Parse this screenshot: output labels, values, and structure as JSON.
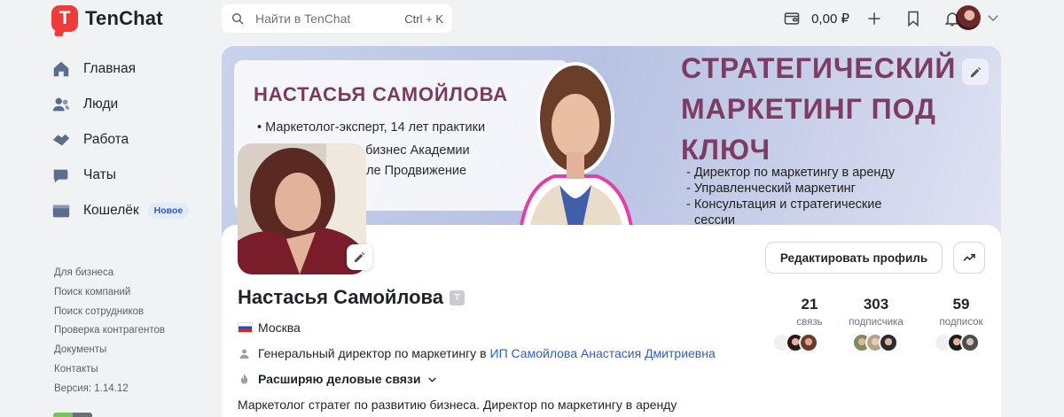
{
  "brand": {
    "name": "TenChat",
    "mark": "T"
  },
  "search": {
    "placeholder": "Найти в TenChat",
    "shortcut": "Ctrl + K"
  },
  "wallet": {
    "amount": "0,00 ₽"
  },
  "nav": [
    {
      "label": "Главная",
      "icon": "home-icon"
    },
    {
      "label": "Люди",
      "icon": "people-icon"
    },
    {
      "label": "Работа",
      "icon": "work-icon"
    },
    {
      "label": "Чаты",
      "icon": "chat-icon"
    },
    {
      "label": "Кошелёк",
      "icon": "wallet-icon",
      "badge": "Новое"
    }
  ],
  "footer_links": [
    "Для бизнеса",
    "Поиск компаний",
    "Поиск сотрудников",
    "Проверка контрагентов",
    "Документы",
    "Контакты",
    "Версия: 1.14.12"
  ],
  "cover": {
    "name": "НАСТАСЬЯ САМОЙЛОВА",
    "bullets": [
      "• Маркетолог-эксперт, 14 лет практики",
      "и бизнес Академии",
      "але Продвижение"
    ],
    "headline_lines": [
      "СТРАТЕГИЧЕСКИЙ",
      "МАРКЕТИНГ ПОД",
      "КЛЮЧ"
    ],
    "list": [
      "- Директор по маркетингу в аренду",
      "- Управленческий маркетинг",
      "- Консультация и стратегические",
      "сессии"
    ]
  },
  "profile": {
    "name": "Настасья Самойлова",
    "city": "Москва",
    "position": "Генеральный директор по маркетингу в",
    "company": "ИП Самойлова Анастасия Дмитриевна",
    "status": "Расширяю деловые связи",
    "bio": "Маркетолог стратег по развитию бизнеса. Директор по маркетингу в аренду",
    "edit_button": "Редактировать профиль"
  },
  "stats": [
    {
      "value": "21",
      "label": "связь"
    },
    {
      "value": "303",
      "label": "подписчика"
    },
    {
      "value": "59",
      "label": "подписок"
    }
  ],
  "colors": {
    "accent": "#f03b3b",
    "link": "#2f5fbf",
    "cover_title": "#7e3b63"
  }
}
